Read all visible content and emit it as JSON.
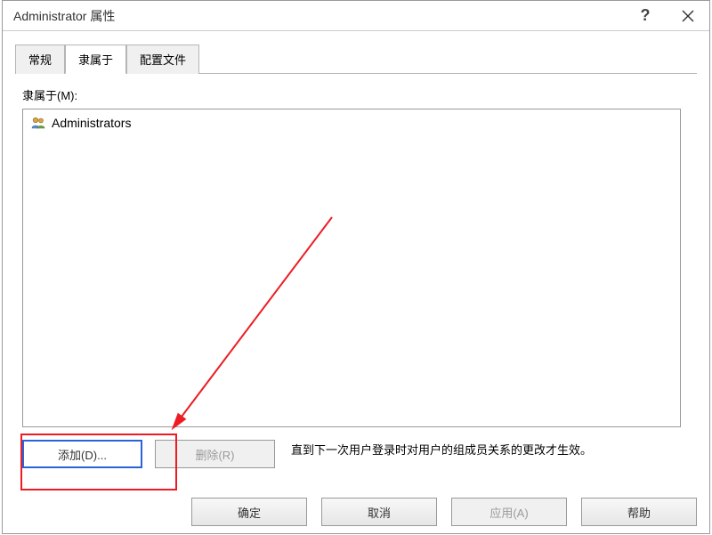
{
  "titlebar": {
    "title": "Administrator 属性"
  },
  "tabs": {
    "general": "常规",
    "memberof": "隶属于",
    "profile": "配置文件"
  },
  "panel": {
    "label": "隶属于(M):",
    "items": [
      {
        "name": "Administrators"
      }
    ],
    "add_label": "添加(D)...",
    "remove_label": "删除(R)",
    "info_text": "直到下一次用户登录时对用户的组成员关系的更改才生效。"
  },
  "buttons": {
    "ok": "确定",
    "cancel": "取消",
    "apply": "应用(A)",
    "help": "帮助"
  }
}
